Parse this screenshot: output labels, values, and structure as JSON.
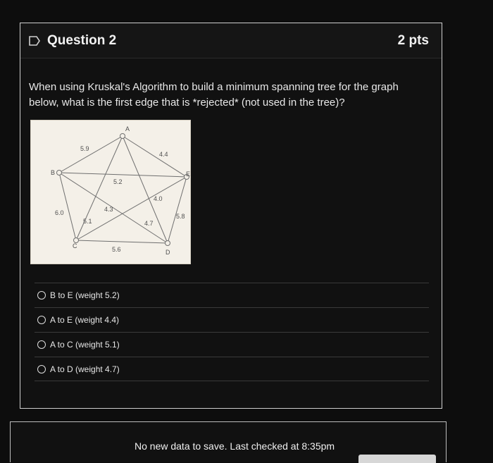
{
  "question": {
    "title": "Question 2",
    "points": "2 pts",
    "prompt": "When using Kruskal's Algorithm to build a minimum spanning tree for the graph below, what is the first edge that is *rejected* (not used in the tree)?",
    "graph": {
      "nodes": {
        "A": "A",
        "B": "B",
        "C": "C",
        "D": "D",
        "E": "E"
      },
      "weights": {
        "ab": "5.9",
        "ae": "4.4",
        "be": "5.2",
        "ed": "4.0",
        "ed_alt": "5.8",
        "bd": "4.3",
        "bc": "6.0",
        "ac": "5.1",
        "ad": "4.7",
        "cd": "5.6"
      }
    },
    "answers": [
      {
        "label": "B to E (weight 5.2)"
      },
      {
        "label": "A to E (weight 4.4)"
      },
      {
        "label": "A to C (weight 5.1)"
      },
      {
        "label": "A to D (weight 4.7)"
      }
    ]
  },
  "status": {
    "text": "No new data to save. Last checked at 8:35pm"
  },
  "colors": {
    "background": "#0d0d0d",
    "card": "#111111",
    "border": "#cfcfcf",
    "graph_background": "#f4f0e8",
    "graph_line": "#6f6f6f",
    "text": "#e6e6e6"
  }
}
